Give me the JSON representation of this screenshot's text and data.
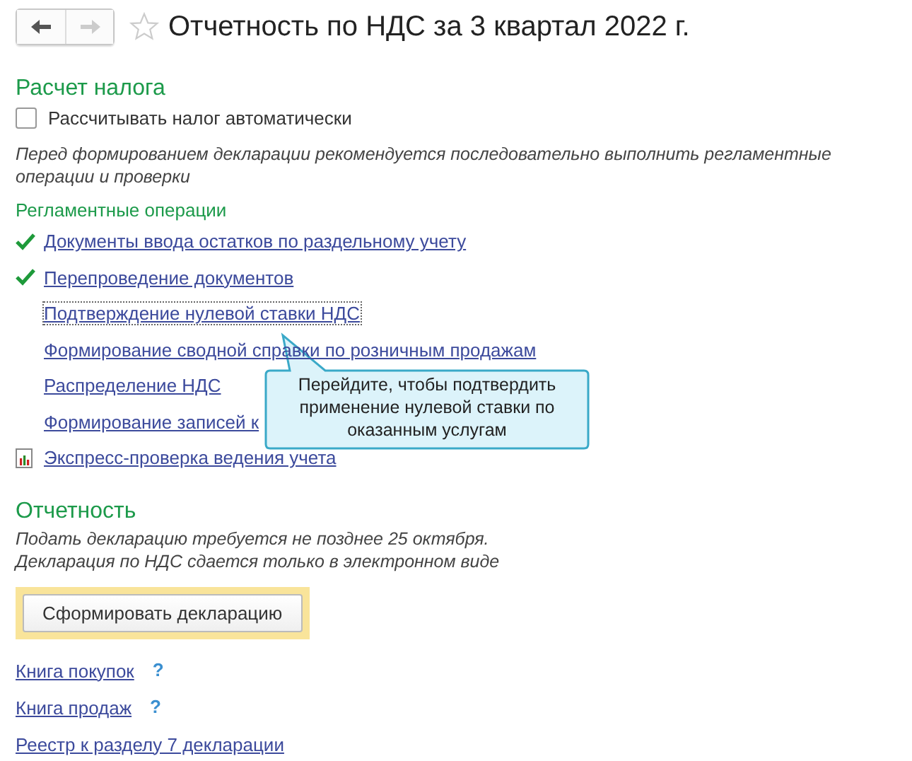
{
  "window": {
    "title": "Отчетность по НДС за 3 квартал 2022 г.",
    "favorite": false
  },
  "tax": {
    "heading": "Расчет налога",
    "auto_checkbox": {
      "label": "Рассчитывать налог автоматически",
      "checked": false
    },
    "note": "Перед формированием декларации рекомендуется последовательно выполнить регламентные операции и проверки",
    "operations_heading": "Регламентные операции",
    "operations": [
      {
        "kind": "done",
        "label": "Документы ввода остатков по раздельному учету",
        "focused": false
      },
      {
        "kind": "done",
        "label": "Перепроведение документов",
        "focused": false
      },
      {
        "kind": "plain",
        "label": "Подтверждение нулевой ставки НДС",
        "focused": true
      },
      {
        "kind": "plain",
        "label": "Формирование сводной справки по розничным продажам",
        "focused": false
      },
      {
        "kind": "plain",
        "label": "Распределение НДС",
        "focused": false
      },
      {
        "kind": "plain",
        "label": "Формирование записей к",
        "focused": false
      },
      {
        "kind": "report",
        "label": "Экспресс-проверка ведения учета",
        "focused": false
      }
    ]
  },
  "tooltip": {
    "text": "Перейдите, чтобы подтвердить применение нулевой ставки по оказанным услугам"
  },
  "reporting": {
    "heading": "Отчетность",
    "note_lines": [
      "Подать декларацию требуется не позднее 25 октября.",
      "Декларация по НДС сдается только в электронном виде"
    ],
    "button": "Сформировать декларацию",
    "links": [
      {
        "label": "Книга покупок",
        "help": "?"
      },
      {
        "label": "Книга продаж",
        "help": "?"
      },
      {
        "label": "Реестр к разделу 7 декларации"
      }
    ]
  }
}
